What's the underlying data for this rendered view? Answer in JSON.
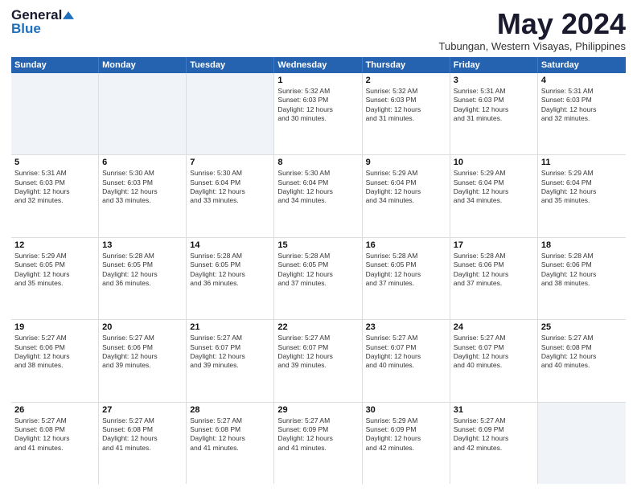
{
  "logo": {
    "general": "General",
    "blue": "Blue"
  },
  "title": {
    "month_year": "May 2024",
    "location": "Tubungan, Western Visayas, Philippines"
  },
  "days_of_week": [
    "Sunday",
    "Monday",
    "Tuesday",
    "Wednesday",
    "Thursday",
    "Friday",
    "Saturday"
  ],
  "weeks": [
    [
      {
        "day": "",
        "info": ""
      },
      {
        "day": "",
        "info": ""
      },
      {
        "day": "",
        "info": ""
      },
      {
        "day": "1",
        "info": "Sunrise: 5:32 AM\nSunset: 6:03 PM\nDaylight: 12 hours\nand 30 minutes."
      },
      {
        "day": "2",
        "info": "Sunrise: 5:32 AM\nSunset: 6:03 PM\nDaylight: 12 hours\nand 31 minutes."
      },
      {
        "day": "3",
        "info": "Sunrise: 5:31 AM\nSunset: 6:03 PM\nDaylight: 12 hours\nand 31 minutes."
      },
      {
        "day": "4",
        "info": "Sunrise: 5:31 AM\nSunset: 6:03 PM\nDaylight: 12 hours\nand 32 minutes."
      }
    ],
    [
      {
        "day": "5",
        "info": "Sunrise: 5:31 AM\nSunset: 6:03 PM\nDaylight: 12 hours\nand 32 minutes."
      },
      {
        "day": "6",
        "info": "Sunrise: 5:30 AM\nSunset: 6:03 PM\nDaylight: 12 hours\nand 33 minutes."
      },
      {
        "day": "7",
        "info": "Sunrise: 5:30 AM\nSunset: 6:04 PM\nDaylight: 12 hours\nand 33 minutes."
      },
      {
        "day": "8",
        "info": "Sunrise: 5:30 AM\nSunset: 6:04 PM\nDaylight: 12 hours\nand 34 minutes."
      },
      {
        "day": "9",
        "info": "Sunrise: 5:29 AM\nSunset: 6:04 PM\nDaylight: 12 hours\nand 34 minutes."
      },
      {
        "day": "10",
        "info": "Sunrise: 5:29 AM\nSunset: 6:04 PM\nDaylight: 12 hours\nand 34 minutes."
      },
      {
        "day": "11",
        "info": "Sunrise: 5:29 AM\nSunset: 6:04 PM\nDaylight: 12 hours\nand 35 minutes."
      }
    ],
    [
      {
        "day": "12",
        "info": "Sunrise: 5:29 AM\nSunset: 6:05 PM\nDaylight: 12 hours\nand 35 minutes."
      },
      {
        "day": "13",
        "info": "Sunrise: 5:28 AM\nSunset: 6:05 PM\nDaylight: 12 hours\nand 36 minutes."
      },
      {
        "day": "14",
        "info": "Sunrise: 5:28 AM\nSunset: 6:05 PM\nDaylight: 12 hours\nand 36 minutes."
      },
      {
        "day": "15",
        "info": "Sunrise: 5:28 AM\nSunset: 6:05 PM\nDaylight: 12 hours\nand 37 minutes."
      },
      {
        "day": "16",
        "info": "Sunrise: 5:28 AM\nSunset: 6:05 PM\nDaylight: 12 hours\nand 37 minutes."
      },
      {
        "day": "17",
        "info": "Sunrise: 5:28 AM\nSunset: 6:06 PM\nDaylight: 12 hours\nand 37 minutes."
      },
      {
        "day": "18",
        "info": "Sunrise: 5:28 AM\nSunset: 6:06 PM\nDaylight: 12 hours\nand 38 minutes."
      }
    ],
    [
      {
        "day": "19",
        "info": "Sunrise: 5:27 AM\nSunset: 6:06 PM\nDaylight: 12 hours\nand 38 minutes."
      },
      {
        "day": "20",
        "info": "Sunrise: 5:27 AM\nSunset: 6:06 PM\nDaylight: 12 hours\nand 39 minutes."
      },
      {
        "day": "21",
        "info": "Sunrise: 5:27 AM\nSunset: 6:07 PM\nDaylight: 12 hours\nand 39 minutes."
      },
      {
        "day": "22",
        "info": "Sunrise: 5:27 AM\nSunset: 6:07 PM\nDaylight: 12 hours\nand 39 minutes."
      },
      {
        "day": "23",
        "info": "Sunrise: 5:27 AM\nSunset: 6:07 PM\nDaylight: 12 hours\nand 40 minutes."
      },
      {
        "day": "24",
        "info": "Sunrise: 5:27 AM\nSunset: 6:07 PM\nDaylight: 12 hours\nand 40 minutes."
      },
      {
        "day": "25",
        "info": "Sunrise: 5:27 AM\nSunset: 6:08 PM\nDaylight: 12 hours\nand 40 minutes."
      }
    ],
    [
      {
        "day": "26",
        "info": "Sunrise: 5:27 AM\nSunset: 6:08 PM\nDaylight: 12 hours\nand 41 minutes."
      },
      {
        "day": "27",
        "info": "Sunrise: 5:27 AM\nSunset: 6:08 PM\nDaylight: 12 hours\nand 41 minutes."
      },
      {
        "day": "28",
        "info": "Sunrise: 5:27 AM\nSunset: 6:08 PM\nDaylight: 12 hours\nand 41 minutes."
      },
      {
        "day": "29",
        "info": "Sunrise: 5:27 AM\nSunset: 6:09 PM\nDaylight: 12 hours\nand 41 minutes."
      },
      {
        "day": "30",
        "info": "Sunrise: 5:29 AM\nSunset: 6:09 PM\nDaylight: 12 hours\nand 42 minutes."
      },
      {
        "day": "31",
        "info": "Sunrise: 5:27 AM\nSunset: 6:09 PM\nDaylight: 12 hours\nand 42 minutes."
      },
      {
        "day": "",
        "info": ""
      }
    ]
  ]
}
